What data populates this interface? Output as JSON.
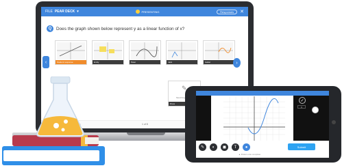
{
  "laptop": {
    "app_bar": {
      "brand": "PEAR DECK",
      "brand_prefix": "FILE",
      "center_label": "PRESENTING",
      "response_label": "Responses",
      "close_glyph": "✕"
    },
    "question": {
      "number": "Q",
      "text": "Does the graph shown below represent y as a linear function of x?"
    },
    "choices": [
      {
        "label": "Student response"
      },
      {
        "label": "Emily"
      },
      {
        "label": "Peter"
      },
      {
        "label": "Jack"
      },
      {
        "label": "Isabel"
      }
    ],
    "sketch_card": {
      "caption": "Sketching drawing",
      "label": "Drew"
    },
    "footer": {
      "page": "1 of 8"
    },
    "nav": {
      "prev": "‹",
      "next": "›"
    }
  },
  "phone": {
    "submit_label": "Submit",
    "note": "▲ Drawn onto complete",
    "check_glyph": "✓",
    "mini_label": "fit"
  },
  "colors": {
    "accent": "#3f86dd",
    "selected": "#f08c2c",
    "book_red": "#b83a4c",
    "book_blue": "#2f8fe8",
    "book_gold": "#f5b93e"
  }
}
